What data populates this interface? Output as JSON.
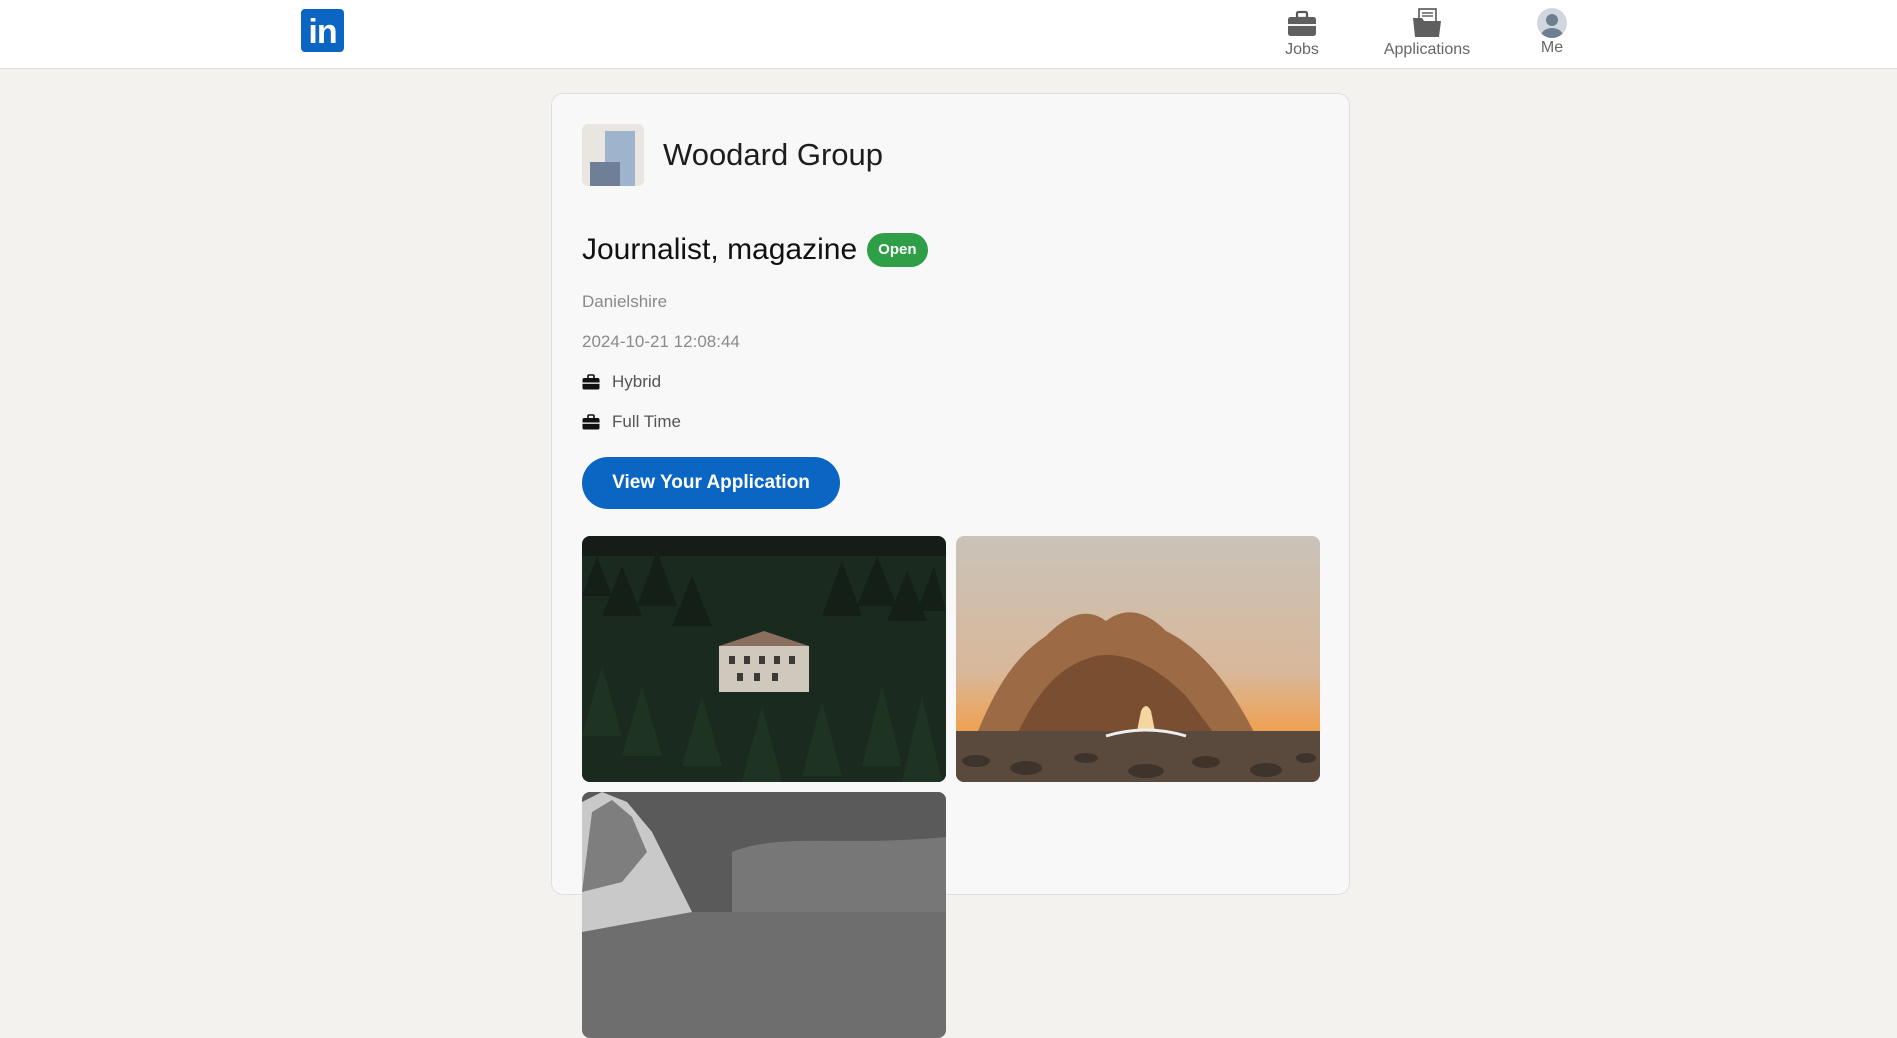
{
  "header": {
    "logo_text": "in",
    "nav": {
      "jobs_label": "Jobs",
      "applications_label": "Applications",
      "me_label": "Me"
    }
  },
  "job": {
    "company_name": "Woodard Group",
    "title": "Journalist, magazine",
    "status": "Open",
    "location": "Danielshire",
    "posted_at": "2024-10-21 12:08:44",
    "workplace_type": "Hybrid",
    "employment_type": "Full Time",
    "view_application_label": "View Your Application"
  },
  "colors": {
    "brand": "#0a66c2",
    "status_open": "#2e9e47",
    "background": "#f3f2ef"
  },
  "icons": {
    "jobs": "briefcase-icon",
    "applications": "folder-documents-icon",
    "me": "avatar-icon",
    "attribute": "briefcase-icon"
  }
}
